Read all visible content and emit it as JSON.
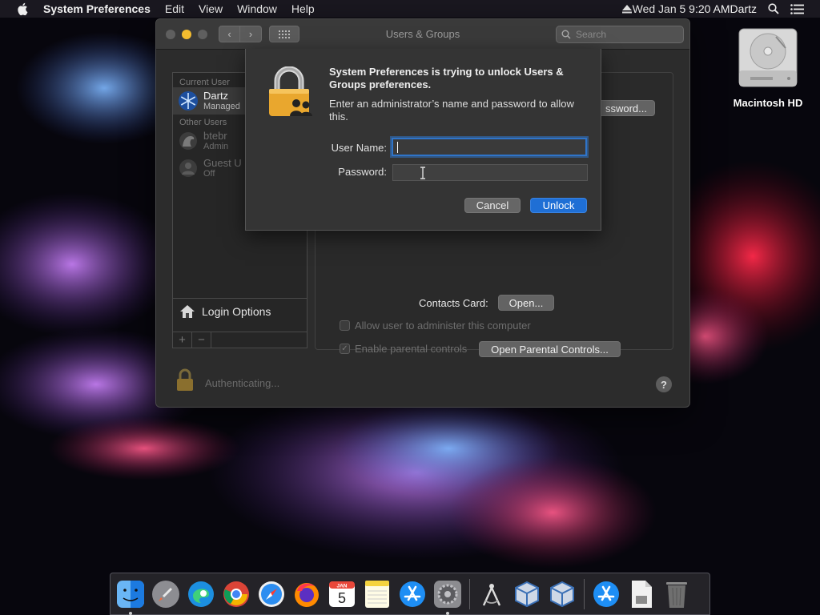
{
  "menubar": {
    "app_name": "System Preferences",
    "menus": [
      "Edit",
      "View",
      "Window",
      "Help"
    ],
    "datetime": "Wed Jan 5  9:20 AM",
    "user": "Dartz"
  },
  "desktop": {
    "disk_label": "Macintosh HD"
  },
  "window": {
    "title": "Users & Groups",
    "search_placeholder": "Search",
    "users_panel": {
      "current_user_header": "Current User",
      "current_user": {
        "name": "Dartz",
        "role": "Managed"
      },
      "other_users_header": "Other Users",
      "other_users": [
        {
          "name": "btebr",
          "role": "Admin"
        },
        {
          "name": "Guest U",
          "role": "Off"
        }
      ],
      "login_options_label": "Login Options",
      "add_label": "+",
      "remove_label": "−"
    },
    "right_pane": {
      "password_button_label": "ssword...",
      "contacts_card_label": "Contacts Card:",
      "open_button_label": "Open...",
      "allow_admin_label": "Allow user to administer this computer",
      "parental_controls_label": "Enable parental controls",
      "open_parental_button_label": "Open Parental Controls..."
    },
    "footer_status": "Authenticating...",
    "help_label": "?"
  },
  "auth_sheet": {
    "title": "System Preferences is trying to unlock Users & Groups preferences.",
    "description": "Enter an administrator’s name and password to allow this.",
    "username_label": "User Name:",
    "username_value": "",
    "password_label": "Password:",
    "password_value": "",
    "cancel_label": "Cancel",
    "unlock_label": "Unlock"
  },
  "dock": {
    "calendar_month": "JAN",
    "calendar_day": "5"
  },
  "colors": {
    "accent": "#1f6fd5",
    "focus_ring": "#2f74c8",
    "window_bg": "#2c2c2c"
  }
}
